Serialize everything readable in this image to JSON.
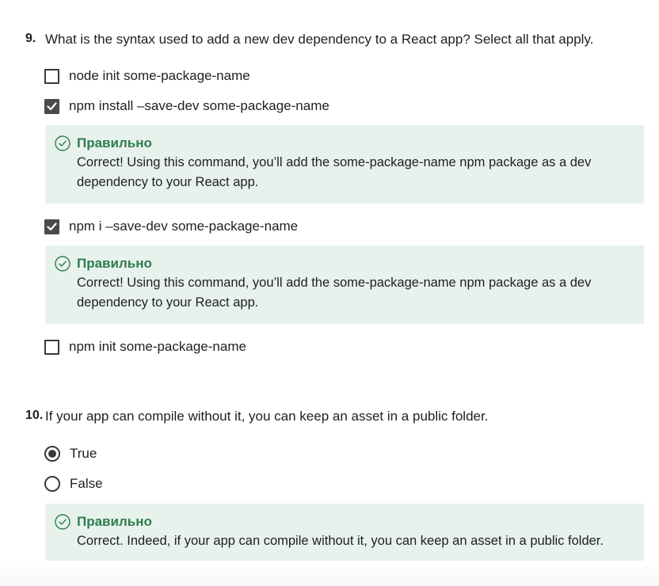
{
  "questions": [
    {
      "number": "9.",
      "text": "What is the syntax used to add a new dev dependency to a React app? Select all that apply.",
      "type": "checkbox",
      "options": [
        {
          "label": "node init some-package-name",
          "checked": false
        },
        {
          "label": "npm install –save-dev some-package-name",
          "checked": true,
          "feedback": {
            "title": "Правильно",
            "text": "Correct! Using this command, you’ll add the some-package-name npm package as a dev dependency to your React app."
          }
        },
        {
          "label": "npm i –save-dev some-package-name",
          "checked": true,
          "feedback": {
            "title": "Правильно",
            "text": "Correct! Using this command, you’ll add the some-package-name npm package as a dev dependency to your React app."
          }
        },
        {
          "label": "npm init some-package-name",
          "checked": false
        }
      ]
    },
    {
      "number": "10.",
      "text": "If your app can compile without it, you can keep an asset in a public folder.",
      "type": "radio",
      "options": [
        {
          "label": "True",
          "checked": true
        },
        {
          "label": "False",
          "checked": false
        }
      ],
      "feedback": {
        "title": "Правильно",
        "text": "Correct. Indeed, if your app can compile without it, you can keep an asset in a public folder."
      }
    }
  ],
  "colors": {
    "correct_title": "#2e7d4f",
    "feedback_bg": "#e8f2ec",
    "control": "#3a3a3a"
  },
  "icons": {
    "feedback": "check-circle-icon",
    "checked": "checkmark-icon"
  }
}
